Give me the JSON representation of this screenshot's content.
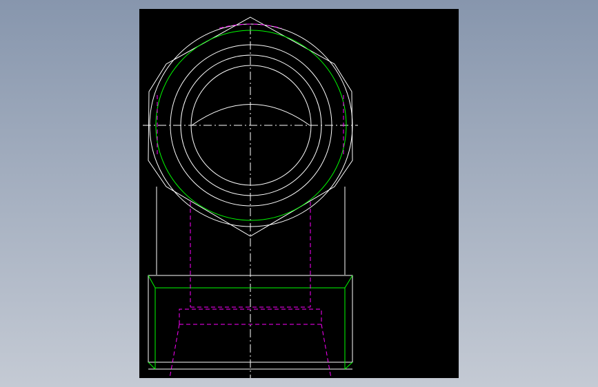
{
  "background": {
    "gradient_top": "#8796ad",
    "gradient_bottom": "#c4cad4"
  },
  "viewport": {
    "background": "#000000"
  },
  "line_colors": {
    "solid": "#ffffff",
    "hidden": "#ff00ff",
    "thread": "#00ff00",
    "center": "#ffffff"
  },
  "icons": [
    "cad-drawing-icon"
  ]
}
